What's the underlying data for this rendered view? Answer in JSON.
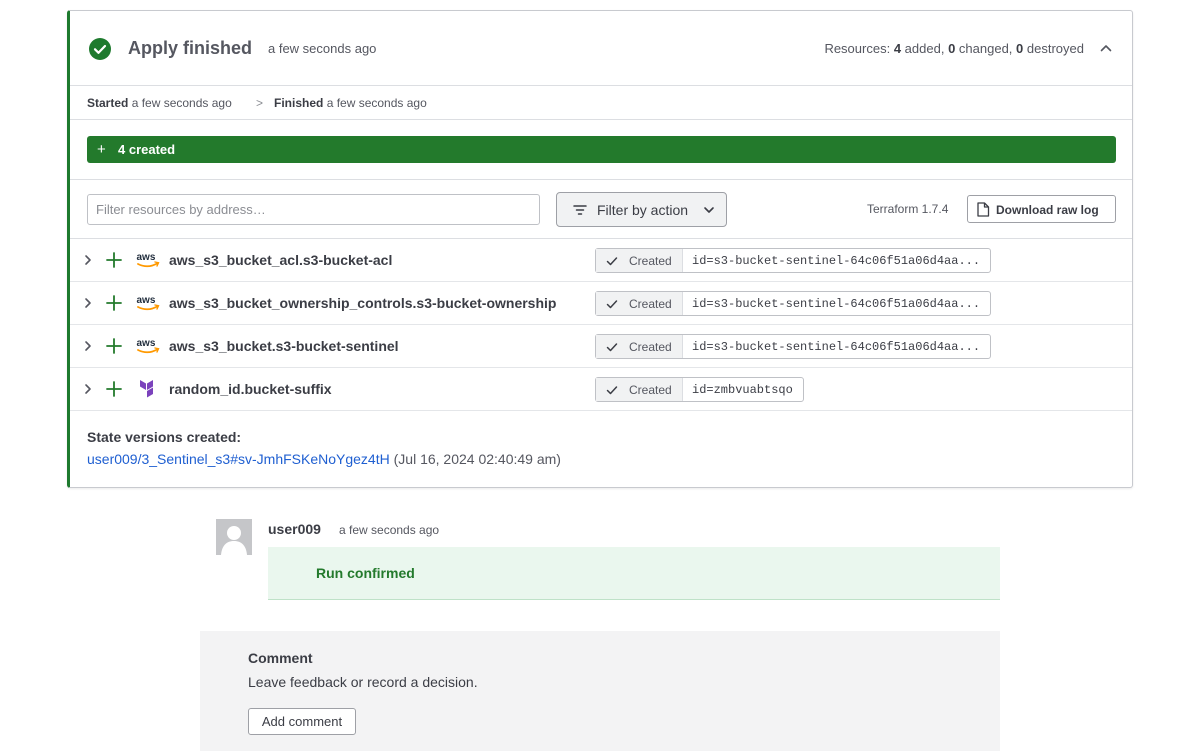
{
  "header": {
    "status_title": "Apply finished",
    "status_time": "a few seconds ago",
    "resources_label": "Resources:",
    "added_count": "4",
    "added_label": "added,",
    "changed_count": "0",
    "changed_label": "changed,",
    "destroyed_count": "0",
    "destroyed_label": "destroyed",
    "collapse_icon": "chevron-up-icon",
    "status_icon": "check-circle-icon",
    "accent_color": "#1e7a2e"
  },
  "timeline": {
    "started_label": "Started",
    "started_time": "a few seconds ago",
    "separator": ">",
    "finished_label": "Finished",
    "finished_time": "a few seconds ago"
  },
  "summary_bar": {
    "plus": "+",
    "label": "4 created",
    "color": "#237a2c"
  },
  "toolbar": {
    "search_placeholder": "Filter resources by address…",
    "filter_label": "Filter by action",
    "terraform_version": "Terraform 1.7.4",
    "download_label": "Download raw log"
  },
  "resources": [
    {
      "provider": "aws",
      "address": "aws_s3_bucket_acl.s3-bucket-acl",
      "status": "Created",
      "id": "id=s3-bucket-sentinel-64c06f51a06d4aa..."
    },
    {
      "provider": "aws",
      "address": "aws_s3_bucket_ownership_controls.s3-bucket-ownership",
      "status": "Created",
      "id": "id=s3-bucket-sentinel-64c06f51a06d4aa..."
    },
    {
      "provider": "aws",
      "address": "aws_s3_bucket.s3-bucket-sentinel",
      "status": "Created",
      "id": "id=s3-bucket-sentinel-64c06f51a06d4aa..."
    },
    {
      "provider": "terraform",
      "address": "random_id.bucket-suffix",
      "status": "Created",
      "id": "id=zmbvuabtsqo"
    }
  ],
  "state": {
    "label": "State versions created:",
    "link": "user009/3_Sentinel_s3#sv-JmhFSKeNoYgez4tH",
    "date": "(Jul 16, 2024 02:40:49 am)"
  },
  "comment_entry": {
    "user": "user009",
    "time": "a few seconds ago",
    "message": "Run confirmed"
  },
  "comment_form": {
    "title": "Comment",
    "subtitle": "Leave feedback or record a decision.",
    "button": "Add comment"
  }
}
